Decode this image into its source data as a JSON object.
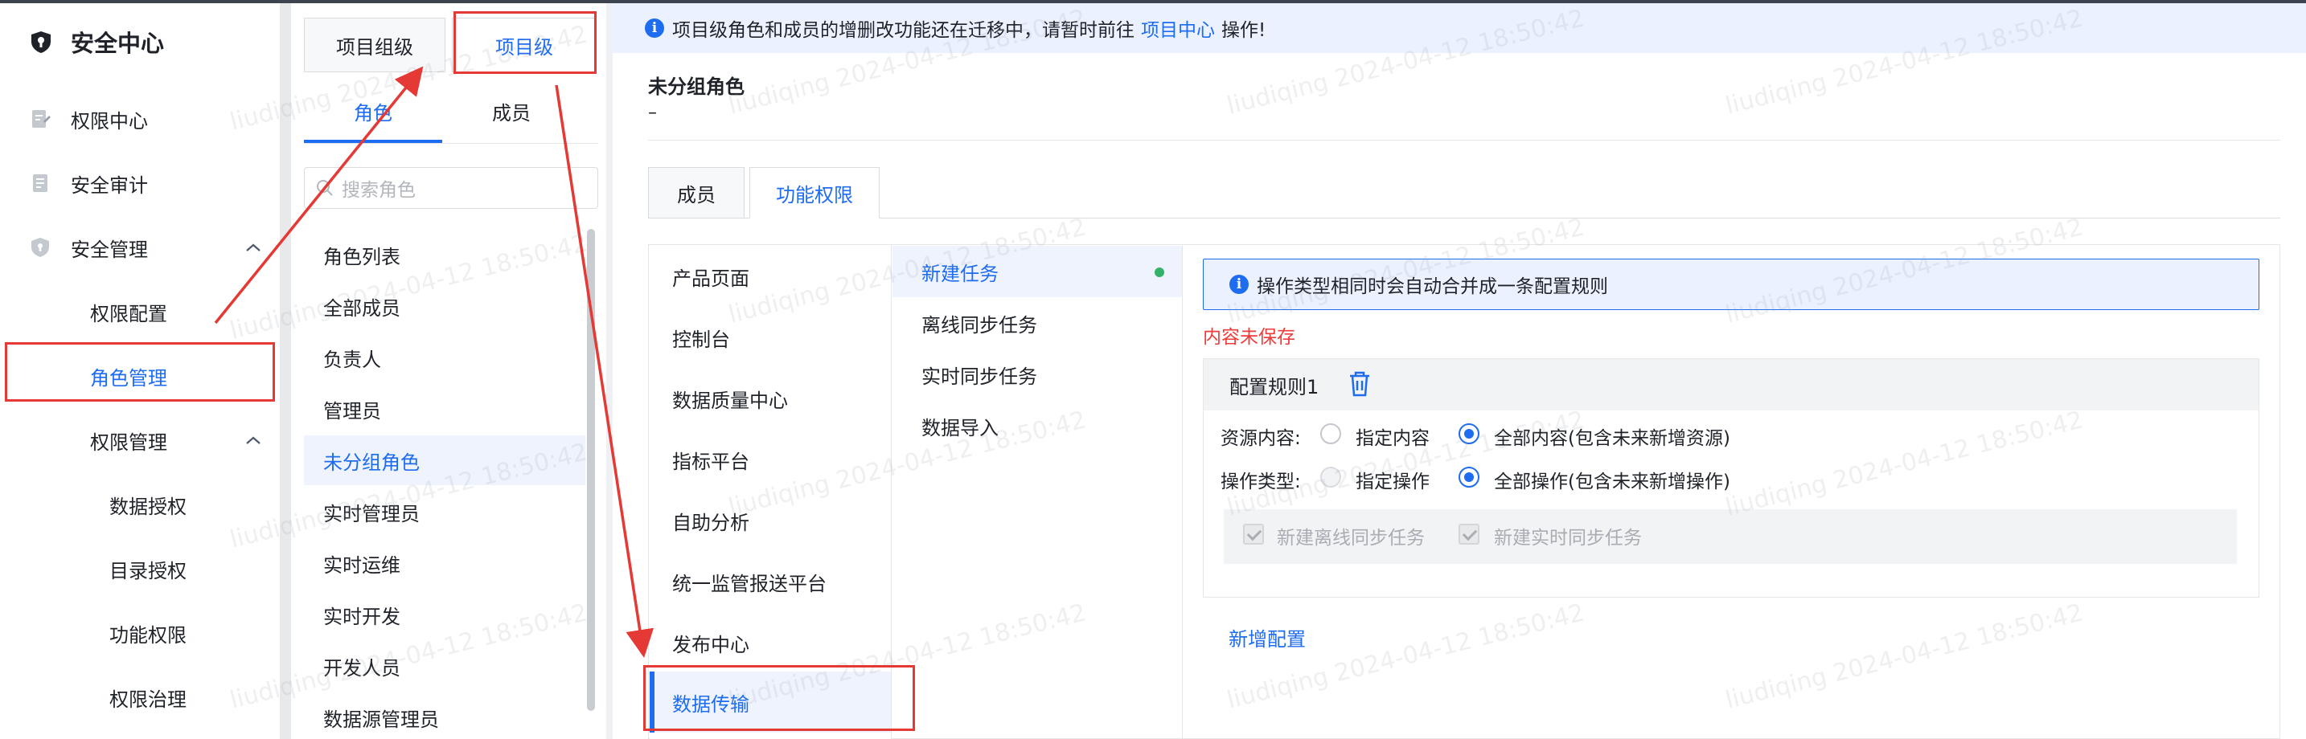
{
  "sidebar": {
    "title": "安全中心",
    "items": [
      {
        "label": "权限中心",
        "icon": "permission-center-icon"
      },
      {
        "label": "安全审计",
        "icon": "audit-icon"
      },
      {
        "label": "安全管理",
        "icon": "shield-icon"
      },
      {
        "label": "权限配置"
      },
      {
        "label": "角色管理"
      },
      {
        "label": "权限管理"
      },
      {
        "label": "数据授权"
      },
      {
        "label": "目录授权"
      },
      {
        "label": "功能权限"
      },
      {
        "label": "权限治理"
      }
    ]
  },
  "panel2": {
    "level_buttons": [
      "项目组级",
      "项目级"
    ],
    "tabs": [
      "角色",
      "成员"
    ],
    "search_placeholder": "搜索角色",
    "roles": [
      "角色列表",
      "全部成员",
      "负责人",
      "管理员",
      "未分组角色",
      "实时管理员",
      "实时运维",
      "实时开发",
      "开发人员",
      "数据源管理员"
    ]
  },
  "notice": {
    "text_before": "项目级角色和成员的增删改功能还在迁移中，请暂时前往",
    "link": "项目中心",
    "text_after": "操作!"
  },
  "group": {
    "title": "未分组角色",
    "desc": "–"
  },
  "main_tabs": [
    "成员",
    "功能权限"
  ],
  "products": [
    "产品页面",
    "控制台",
    "数据质量中心",
    "指标平台",
    "自助分析",
    "统一监管报送平台",
    "发布中心",
    "数据传输"
  ],
  "tasks": [
    "新建任务",
    "离线同步任务",
    "实时同步任务",
    "数据导入"
  ],
  "config": {
    "tip": "操作类型相同时会自动合并成一条配置规则",
    "unsaved": "内容未保存",
    "rule_title": "配置规则1",
    "resource_label": "资源内容:",
    "resource_opt1": "指定内容",
    "resource_opt2": "全部内容(包含未来新增资源)",
    "op_label": "操作类型:",
    "op_opt1": "指定操作",
    "op_opt2": "全部操作(包含未来新增操作)",
    "check1": "新建离线同步任务",
    "check2": "新建实时同步任务",
    "add": "新增配置"
  },
  "watermark": "liudiqing 2024-04-12 18:50:42",
  "colors": {
    "accent": "#1e6cf0",
    "annotation": "#e53935",
    "unsaved": "#f03b3b"
  }
}
